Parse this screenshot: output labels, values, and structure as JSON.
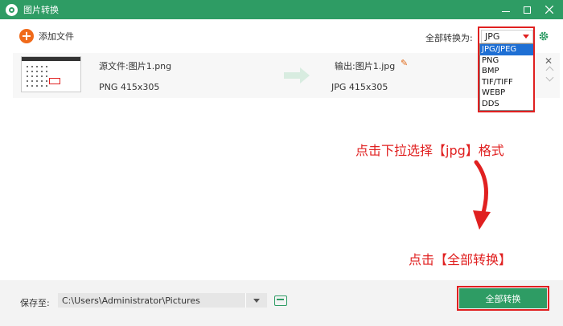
{
  "window": {
    "title": "图片转换"
  },
  "toolbar": {
    "add_file_label": "添加文件",
    "convert_all_label": "全部转换为:",
    "selected_format": "JPG"
  },
  "dropdown": {
    "options": [
      "JPG/JPEG",
      "PNG",
      "BMP",
      "TIF/TIFF",
      "WEBP",
      "DDS"
    ],
    "selected_index": 0
  },
  "file": {
    "source_name": "源文件:图片1.png",
    "source_meta": "PNG   415x305",
    "output_name": "输出:图片1.jpg",
    "output_meta": "JPG   415x305"
  },
  "annotations": {
    "step1": "点击下拉选择【jpg】格式",
    "step2": "点击【全部转换】"
  },
  "bottom": {
    "save_label": "保存至:",
    "save_path": "C:\\Users\\Administrator\\Pictures",
    "convert_all_button": "全部转换"
  },
  "colors": {
    "brand_green": "#2e9c64",
    "annotation_red": "#e02020",
    "add_orange": "#f06a1a",
    "selection_blue": "#1e6fd4"
  }
}
